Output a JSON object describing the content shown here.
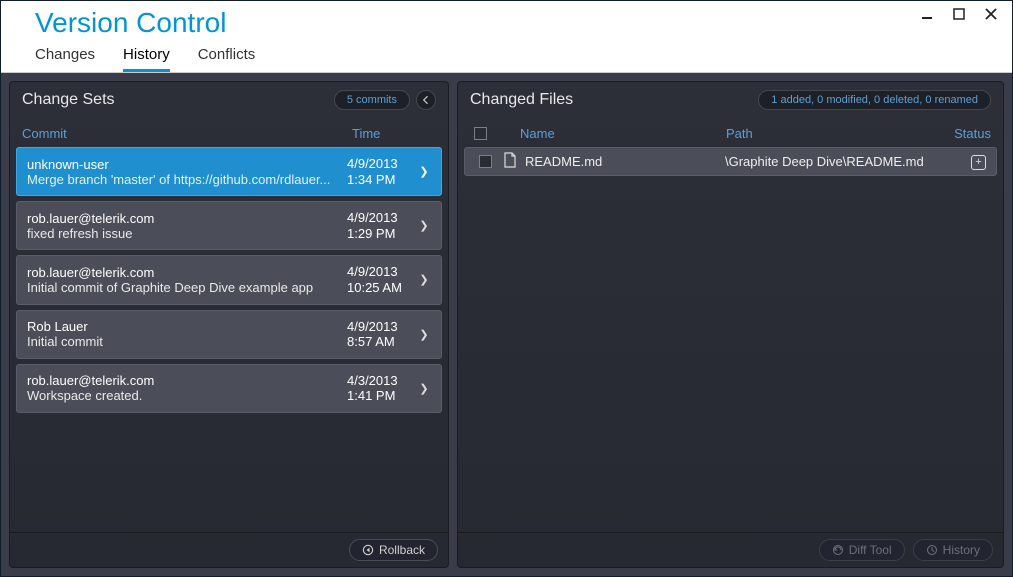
{
  "window": {
    "title": "Version Control"
  },
  "tabs": {
    "changes": "Changes",
    "history": "History",
    "conflicts": "Conflicts"
  },
  "changeSets": {
    "title": "Change Sets",
    "countBadge": "5 commits",
    "headers": {
      "commit": "Commit",
      "time": "Time"
    },
    "rows": [
      {
        "author": "unknown-user",
        "message": "Merge branch 'master' of https://github.com/rdlauer...",
        "date": "4/9/2013",
        "time": "1:34 PM",
        "selected": true
      },
      {
        "author": "rob.lauer@telerik.com",
        "message": "fixed refresh issue",
        "date": "4/9/2013",
        "time": "1:29 PM",
        "selected": false
      },
      {
        "author": "rob.lauer@telerik.com",
        "message": "Initial commit of Graphite Deep Dive example app",
        "date": "4/9/2013",
        "time": "10:25 AM",
        "selected": false
      },
      {
        "author": "Rob Lauer",
        "message": "Initial commit",
        "date": "4/9/2013",
        "time": "8:57 AM",
        "selected": false
      },
      {
        "author": "rob.lauer@telerik.com",
        "message": "Workspace created.",
        "date": "4/3/2013",
        "time": "1:41 PM",
        "selected": false
      }
    ],
    "rollback": "Rollback"
  },
  "changedFiles": {
    "title": "Changed Files",
    "summary": "1 added, 0 modified, 0 deleted, 0 renamed",
    "headers": {
      "name": "Name",
      "path": "Path",
      "status": "Status"
    },
    "rows": [
      {
        "name": "README.md",
        "path": "\\Graphite Deep Dive\\README.md",
        "status": "added"
      }
    ],
    "diffTool": "Diff Tool",
    "history": "History"
  }
}
